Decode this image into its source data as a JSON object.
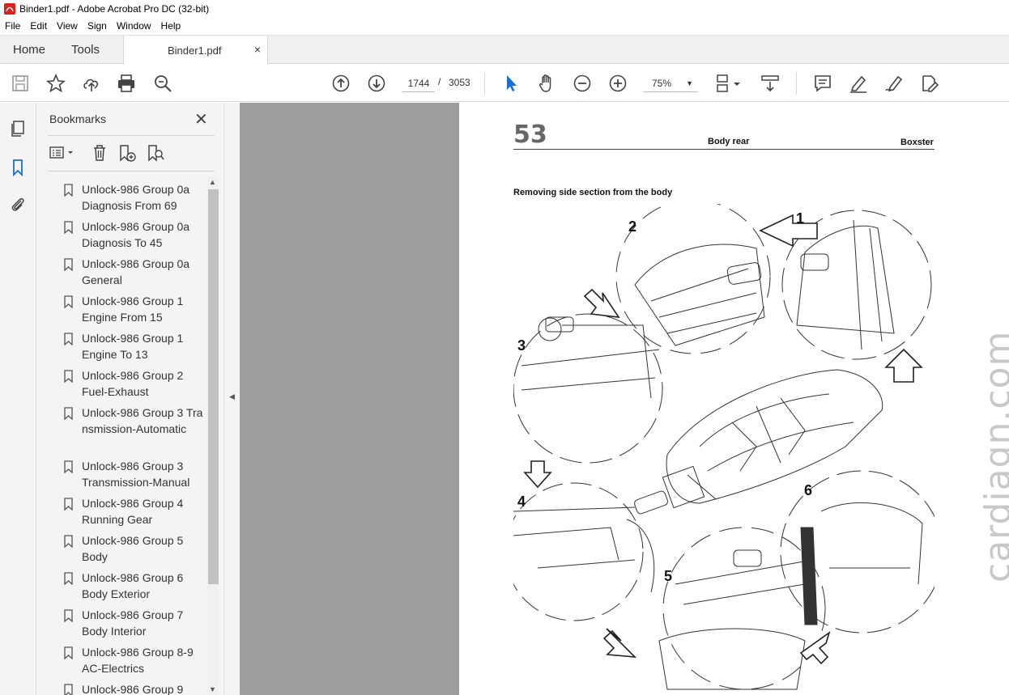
{
  "window": {
    "title": "Binder1.pdf - Adobe Acrobat Pro DC (32-bit)"
  },
  "menu": [
    "File",
    "Edit",
    "View",
    "Sign",
    "Window",
    "Help"
  ],
  "tabs": {
    "home": "Home",
    "tools": "Tools",
    "document": "Binder1.pdf",
    "close": "×"
  },
  "toolbar": {
    "current_page": "1744",
    "separator": "/",
    "total_pages": "3053",
    "zoom": "75%"
  },
  "panel": {
    "title": "Bookmarks",
    "close": "✕",
    "items": [
      "Unlock-986 Group 0a Diagnosis From 69",
      "Unlock-986 Group 0a Diagnosis To 45",
      "Unlock-986 Group 0a General",
      "Unlock-986 Group 1 Engine From 15",
      "Unlock-986 Group 1 Engine To 13",
      "Unlock-986 Group 2 Fuel-Exhaust",
      "Unlock-986 Group 3 Transmission-Automatic",
      "Unlock-986 Group 3 Transmission-Manual",
      "Unlock-986 Group 4 Running Gear",
      "Unlock-986 Group 5 Body",
      "Unlock-986 Group 6 Body Exterior",
      "Unlock-986 Group 7 Body Interior",
      "Unlock-986 Group 8-9 AC-Electrics",
      "Unlock-986 Group 9"
    ]
  },
  "page": {
    "number": "53",
    "section": "Body rear",
    "model": "Boxster",
    "heading": "Removing side section from the body",
    "callouts": [
      "1",
      "2",
      "3",
      "4",
      "5",
      "6"
    ]
  },
  "watermark": "cardiagn.com"
}
